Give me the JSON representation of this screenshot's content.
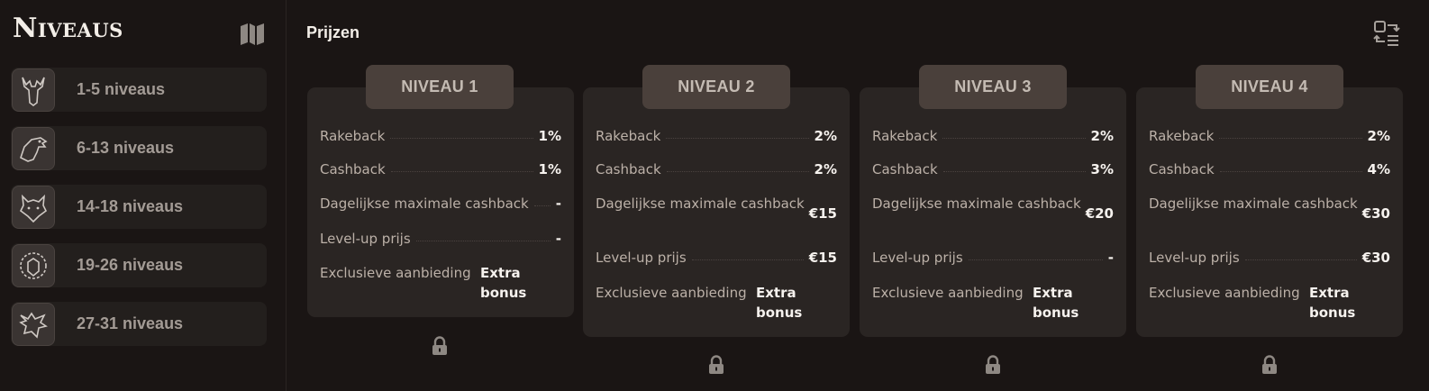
{
  "sidebar": {
    "title": "Niveaus",
    "items": [
      {
        "label": "1-5 niveaus",
        "icon": "moose-icon"
      },
      {
        "label": "6-13 niveaus",
        "icon": "eagle-icon"
      },
      {
        "label": "14-18 niveaus",
        "icon": "wolf-icon"
      },
      {
        "label": "19-26 niveaus",
        "icon": "lion-icon"
      },
      {
        "label": "27-31 niveaus",
        "icon": "dragon-icon"
      }
    ]
  },
  "main": {
    "title": "Prijzen",
    "cards": [
      {
        "title": "NIVEAU 1",
        "rakeback_label": "Rakeback",
        "rakeback": "1%",
        "cashback_label": "Cashback",
        "cashback": "1%",
        "daily_label": "Dagelijkse maximale cashback",
        "daily": "-",
        "levelup_label": "Level-up prijs",
        "levelup": "-",
        "exclusive_label": "Exclusieve aanbieding",
        "exclusive": "Extra bonus"
      },
      {
        "title": "NIVEAU 2",
        "rakeback_label": "Rakeback",
        "rakeback": "2%",
        "cashback_label": "Cashback",
        "cashback": "2%",
        "daily_label": "Dagelijkse maximale cashback",
        "daily": "€15",
        "levelup_label": "Level-up prijs",
        "levelup": "€15",
        "exclusive_label": "Exclusieve aanbieding",
        "exclusive": "Extra bonus"
      },
      {
        "title": "NIVEAU 3",
        "rakeback_label": "Rakeback",
        "rakeback": "2%",
        "cashback_label": "Cashback",
        "cashback": "3%",
        "daily_label": "Dagelijkse maximale cashback",
        "daily": "€20",
        "levelup_label": "Level-up prijs",
        "levelup": "-",
        "exclusive_label": "Exclusieve aanbieding",
        "exclusive": "Extra bonus"
      },
      {
        "title": "NIVEAU 4",
        "rakeback_label": "Rakeback",
        "rakeback": "2%",
        "cashback_label": "Cashback",
        "cashback": "4%",
        "daily_label": "Dagelijkse maximale cashback",
        "daily": "€30",
        "levelup_label": "Level-up prijs",
        "levelup": "€30",
        "exclusive_label": "Exclusieve aanbieding",
        "exclusive": "Extra bonus"
      }
    ]
  },
  "colors": {
    "background": "#1a1514",
    "card": "#2a2523",
    "tab": "#4a403b",
    "value_text": "#f6f2ee"
  },
  "icons": {
    "map": "map-icon",
    "swap": "swap-list-icon",
    "lock": "lock-icon"
  }
}
